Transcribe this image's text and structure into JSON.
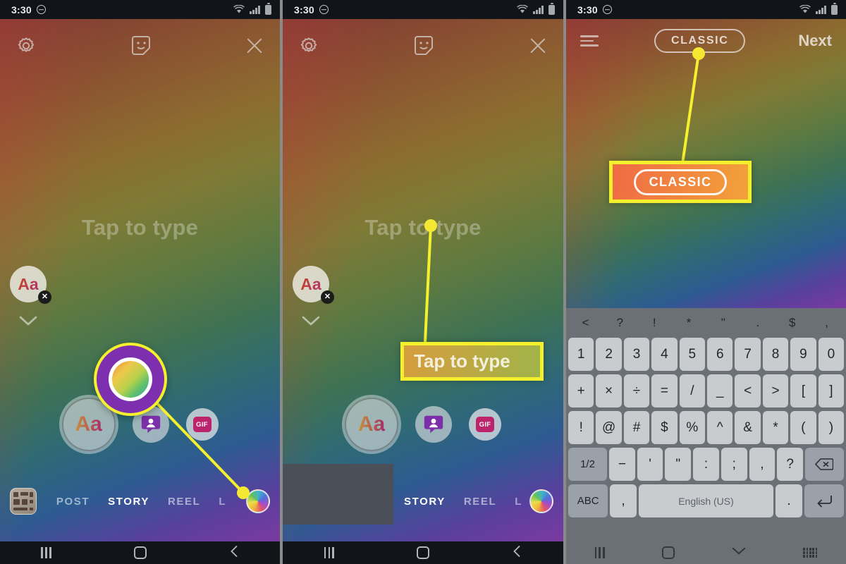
{
  "statusbar": {
    "time": "3:30",
    "dnd_icon": "do-not-disturb-icon",
    "wifi_icon": "wifi-icon",
    "signal_icon": "cell-signal-icon",
    "battery_icon": "battery-icon"
  },
  "panel1": {
    "toolbar": {
      "settings_icon": "gear-icon",
      "sticker_icon": "sticker-icon",
      "close_icon": "close-icon"
    },
    "placeholder": "Tap to type",
    "text_chip": {
      "label": "Aa",
      "remove_icon": "close-badge-icon"
    },
    "chevron_icon": "chevron-down-icon",
    "actions": {
      "text_label": "Aa",
      "avatar_icon": "avatar-icon",
      "gif_label": "GIF"
    },
    "modes": [
      "POST",
      "STORY",
      "REEL",
      "L"
    ],
    "active_mode": "STORY",
    "gallery_icon": "gallery-thumbnail-icon",
    "color_wheel_icon": "color-wheel-icon"
  },
  "panel2": {
    "toolbar": {
      "settings_icon": "gear-icon",
      "sticker_icon": "sticker-icon",
      "close_icon": "close-icon"
    },
    "placeholder": "Tap to type",
    "text_chip": {
      "label": "Aa",
      "remove_icon": "close-badge-icon"
    },
    "chevron_icon": "chevron-down-icon",
    "actions": {
      "text_label": "Aa",
      "avatar_icon": "avatar-icon",
      "gif_label": "GIF"
    },
    "modes": [
      "STORY",
      "REEL",
      "L"
    ],
    "active_mode": "STORY",
    "callout_label": "Tap to type",
    "color_wheel_icon": "color-wheel-icon"
  },
  "panel3": {
    "toolbar": {
      "align_icon": "text-align-icon",
      "font_style": "CLASSIC",
      "next_label": "Next"
    },
    "callout_label": "CLASSIC",
    "keyboard": {
      "suggestions": [
        "<",
        "?",
        "!",
        "*",
        "\"",
        ".",
        "$",
        ","
      ],
      "row1": [
        "1",
        "2",
        "3",
        "4",
        "5",
        "6",
        "7",
        "8",
        "9",
        "0"
      ],
      "row2": [
        "+",
        "×",
        "÷",
        "=",
        "/",
        "_",
        "<",
        ">",
        "[",
        "]"
      ],
      "row3": [
        "!",
        "@",
        "#",
        "$",
        "%",
        "^",
        "&",
        "*",
        "(",
        ")"
      ],
      "row4": {
        "shift": "1/2",
        "keys": [
          "−",
          "'",
          "\"",
          ":",
          ";",
          ",",
          "?"
        ],
        "backspace_icon": "backspace-icon"
      },
      "row5": {
        "abc": "ABC",
        "comma": ",",
        "space": "English (US)",
        "period": ".",
        "enter_icon": "enter-icon"
      }
    }
  },
  "navbar": {
    "recents_icon": "recents-icon",
    "home_icon": "home-icon",
    "back_icon": "back-icon",
    "hide_keyboard_icon": "chevron-down-icon",
    "keyboard_switch_icon": "keyboard-switch-icon"
  },
  "colors": {
    "highlight": "#f5f02e",
    "accent_orange": "#f06a44",
    "keyboard_bg": "#6b7077",
    "key_bg": "#c8cccf"
  }
}
